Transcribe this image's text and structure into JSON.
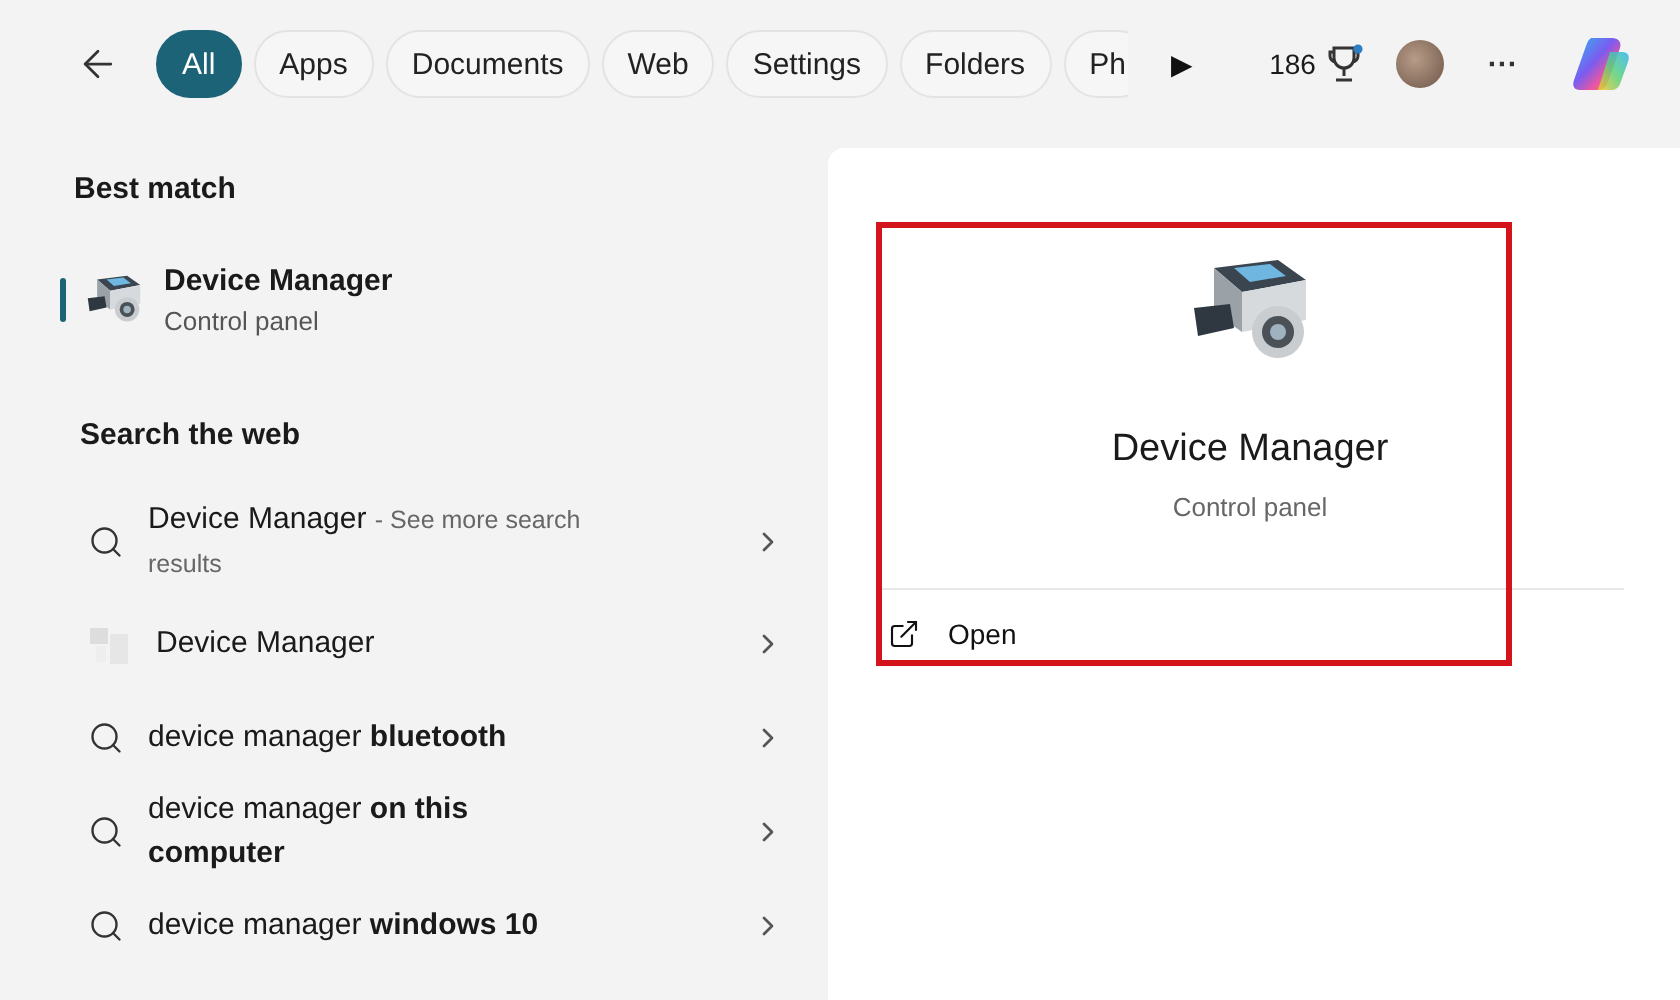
{
  "filters": [
    {
      "label": "All",
      "selected": true
    },
    {
      "label": "Apps",
      "selected": false
    },
    {
      "label": "Documents",
      "selected": false
    },
    {
      "label": "Web",
      "selected": false
    },
    {
      "label": "Settings",
      "selected": false
    },
    {
      "label": "Folders",
      "selected": false
    },
    {
      "label": "Ph",
      "selected": false
    }
  ],
  "more_filters": "▶",
  "points": "186",
  "menu": "···",
  "best_match": {
    "heading": "Best match",
    "title": "Device Manager",
    "subtitle": "Control panel",
    "selected": true
  },
  "web": {
    "heading": "Search the web",
    "items": [
      {
        "kind": "search",
        "text": "Device Manager",
        "suffix": "- See more search results"
      },
      {
        "kind": "site",
        "text": "Device Manager"
      },
      {
        "kind": "search",
        "text": "device manager **bluetooth**"
      },
      {
        "kind": "search",
        "text": "device manager **on this computer**"
      },
      {
        "kind": "search",
        "text": "device manager **windows 10**"
      }
    ]
  },
  "detail": {
    "title": "Device Manager",
    "subtitle": "Control panel",
    "highlight": true,
    "actions": [
      {
        "label": "Open"
      }
    ]
  }
}
